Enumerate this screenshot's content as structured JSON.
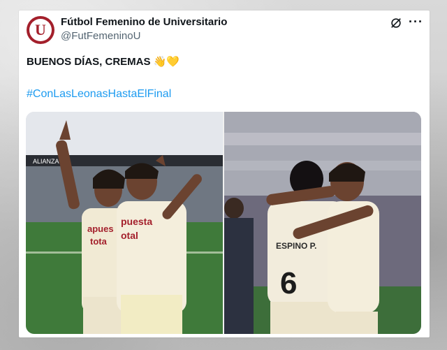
{
  "tweet": {
    "author_name": "Fútbol Femenino de Universitario",
    "handle": "@FutFemeninoU",
    "avatar_letter": "U",
    "text": "BUENOS DÍAS, CREMAS",
    "emojis": "👋💛",
    "hashtag": "#ConLasLeonasHastaElFinal"
  },
  "icons": {
    "grok": "grok-icon",
    "more": "more-icon"
  },
  "photo1": {
    "stadium_sign": "ALIANZA",
    "shirt_sponsor_left": [
      "apues",
      "tota"
    ],
    "shirt_sponsor_right": [
      "puesta",
      "otal"
    ]
  },
  "photo2": {
    "player_name": "ESPINO P.",
    "player_number": "6"
  },
  "colors": {
    "brand": "#a31f2b",
    "link": "#1d9bf0",
    "text": "#0f1419",
    "muted": "#536471"
  }
}
